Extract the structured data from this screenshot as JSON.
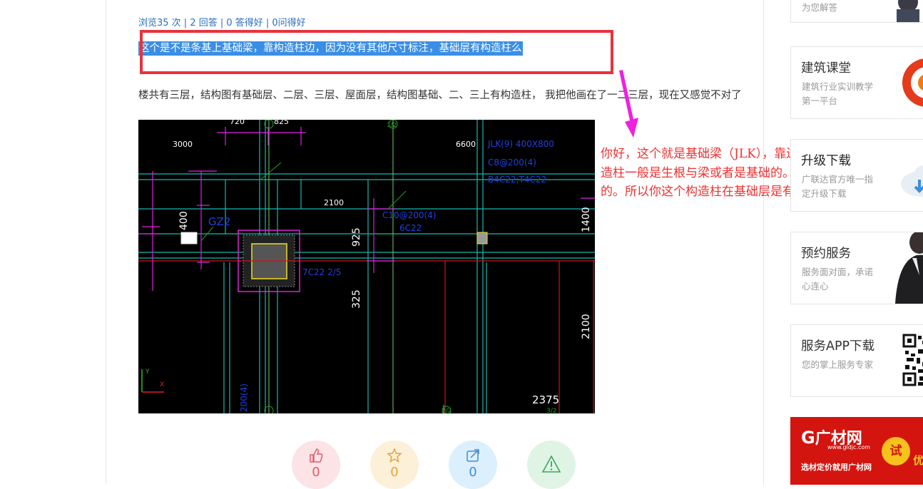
{
  "question": {
    "stats": "浏览35 次 | 2 回答 | 0 答得好 | 0问得好",
    "title": "这个是不是条基上基础梁，靠构造柱边，因为没有其他尺寸标注，基础层有构造柱么",
    "body": "楼共有三层，结构图有基础层、二层、三层、屋面层，结构图基础、二、三上有构造柱， 我把他画在了一二三层，现在又感觉不对了"
  },
  "cad_image": {
    "labels": [
      "720",
      "825",
      "1/2",
      "3000",
      "6600",
      "JLK(9) 400X800",
      "C8@200(4)",
      "B4C22;T4C22",
      "2100",
      "400",
      "GZ2",
      "C10@200(4)",
      "6C22",
      "925",
      "1400",
      "7C22 2/5",
      "325",
      "2100",
      "200(4)",
      "2",
      "2/2",
      "2375",
      "3/2",
      "Y",
      "X"
    ]
  },
  "annotation": {
    "text": "你好，这个就是基础梁（JLK），靠边的就是构造柱，这个构造柱一般是生根与梁或者是基础的。他不能是在空中隔着的。所以你这个构造柱在基础层是有的。",
    "color": "#f03030",
    "arrow_color": "#f020e0",
    "box_color": "#e8323c"
  },
  "sidebar": {
    "top_card_desc": "为您解答",
    "cards": [
      {
        "title": "建筑课堂",
        "desc": "建筑行业实训教学第一平台",
        "icon": "course-logo-icon"
      },
      {
        "title": "升级下载",
        "desc": "广联达官方唯一指定升级下载",
        "icon": "cloud-download-icon"
      },
      {
        "title": "预约服务",
        "desc": "服务面对面，承诺心连心",
        "icon": "service-person-icon"
      },
      {
        "title": "服务APP下载",
        "desc": "您的掌上服务专家",
        "icon": "qr-code-icon"
      }
    ],
    "ad": {
      "logo": "广材网",
      "url": "www.gldjc.com",
      "slogan": "选材定价就用广材网",
      "try": "试",
      "extra": "优"
    }
  },
  "actions": [
    {
      "name": "like",
      "count": "0",
      "color": "#fbe3e6",
      "icon_color": "#e45a6c"
    },
    {
      "name": "favorite",
      "count": "0",
      "color": "#fdf0d9",
      "icon_color": "#e3a33e"
    },
    {
      "name": "share",
      "count": "0",
      "color": "#dbeffc",
      "icon_color": "#3f8fd1"
    },
    {
      "name": "report",
      "count": "",
      "color": "#e0f4e6",
      "icon_color": "#3aa85a"
    }
  ]
}
